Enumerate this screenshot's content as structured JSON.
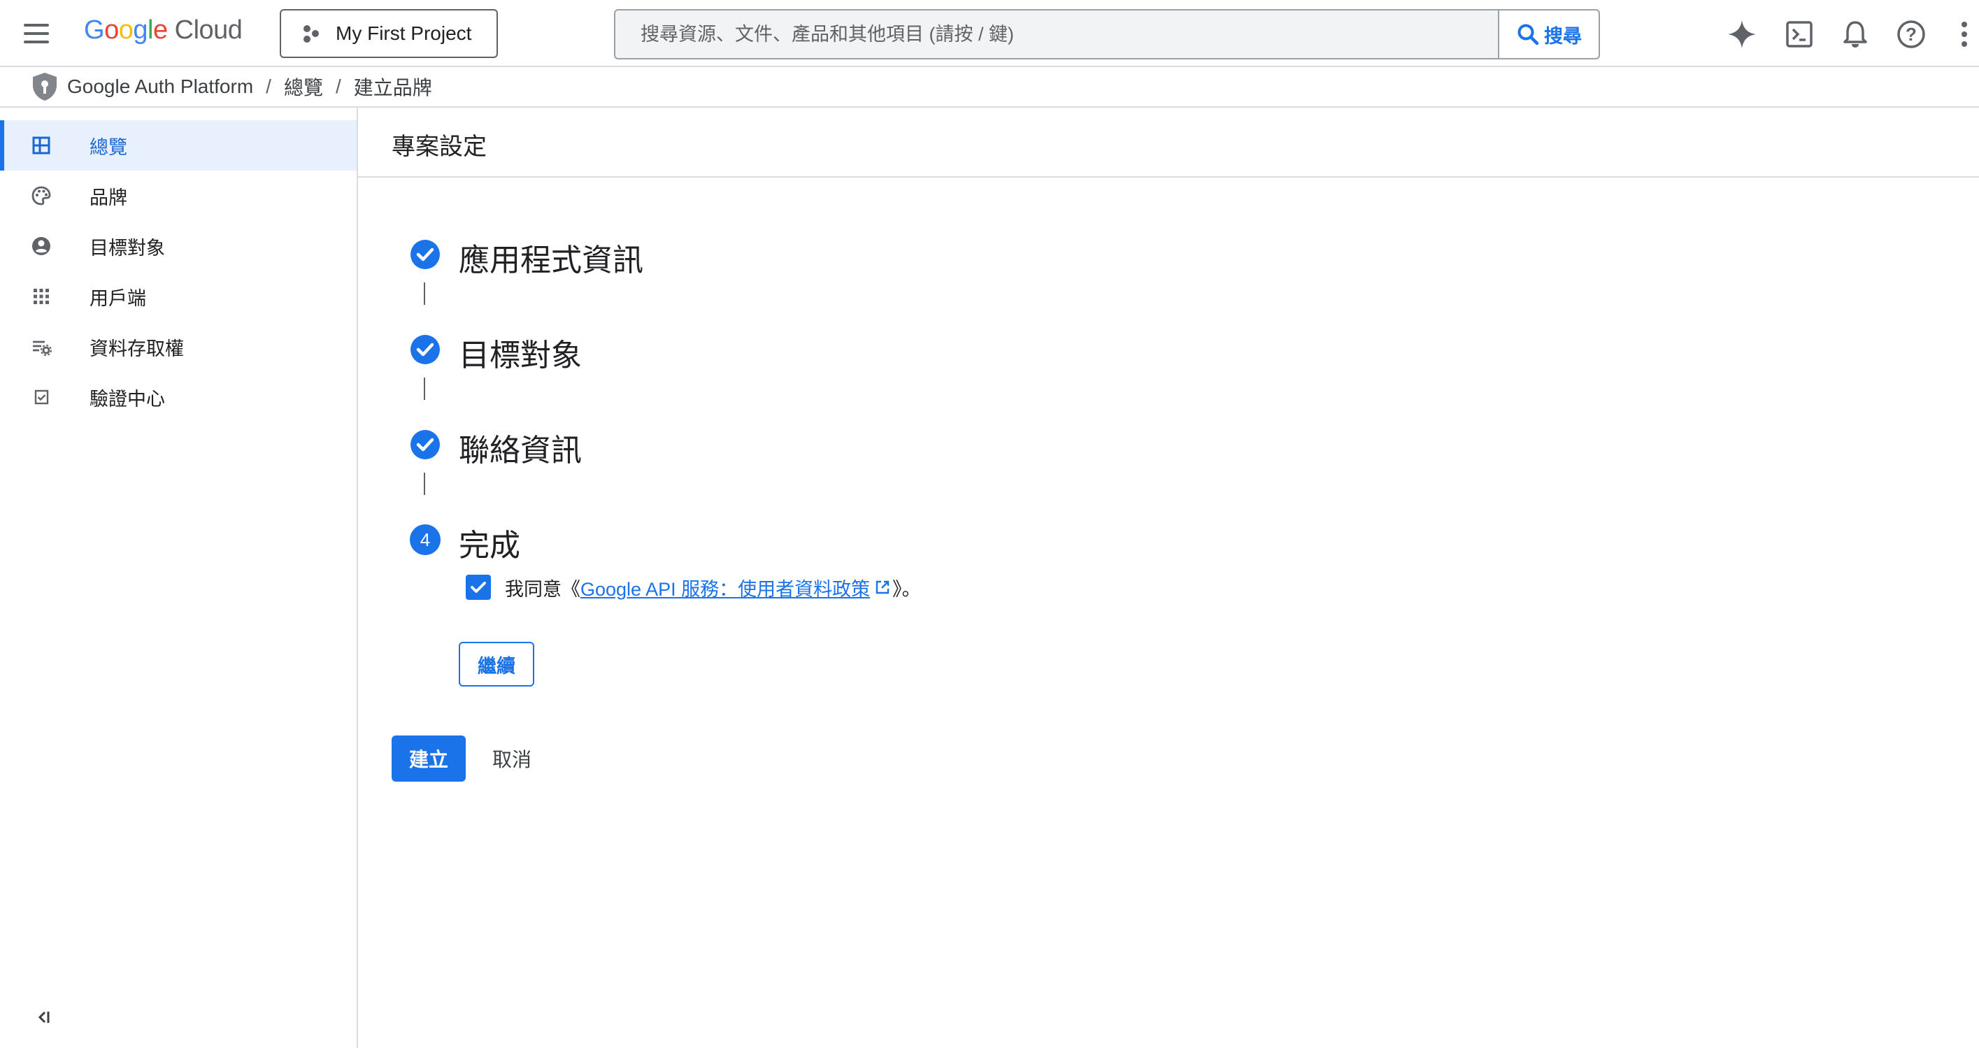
{
  "header": {
    "logo_google": "Google",
    "logo_cloud": "Cloud",
    "project_name": "My First Project",
    "search_placeholder": "搜尋資源、文件、產品和其他項目 (請按 / 鍵)",
    "search_button": "搜尋",
    "icons": [
      "gemini-sparkle-icon",
      "cloud-shell-icon",
      "notifications-bell-icon",
      "help-icon",
      "more-vert-icon"
    ]
  },
  "breadcrumb": {
    "items": [
      "Google Auth Platform",
      "總覽",
      "建立品牌"
    ],
    "separator": "/"
  },
  "sidebar": {
    "items": [
      {
        "label": "總覽",
        "icon": "dashboard-icon",
        "active": true
      },
      {
        "label": "品牌",
        "icon": "palette-icon",
        "active": false
      },
      {
        "label": "目標對象",
        "icon": "account-circle-icon",
        "active": false
      },
      {
        "label": "用戶端",
        "icon": "apps-grid-icon",
        "active": false
      },
      {
        "label": "資料存取權",
        "icon": "data-settings-icon",
        "active": false
      },
      {
        "label": "驗證中心",
        "icon": "verified-checkbox-icon",
        "active": false
      }
    ],
    "collapse_icon": "collapse-left-icon"
  },
  "main": {
    "title": "專案設定",
    "steps": [
      {
        "title": "應用程式資訊",
        "status": "complete"
      },
      {
        "title": "目標對象",
        "status": "complete"
      },
      {
        "title": "聯絡資訊",
        "status": "complete"
      },
      {
        "title": "完成",
        "status": "current",
        "number": "4"
      }
    ],
    "agree": {
      "checked": true,
      "prefix": "我同意《",
      "link_text": "Google API 服務：使用者資料政策",
      "suffix": "》。"
    },
    "continue_label": "繼續",
    "create_label": "建立",
    "cancel_label": "取消"
  },
  "colors": {
    "accent": "#1a73e8",
    "active_bg": "#e8f0fe",
    "border": "#dadce0",
    "text": "#202124",
    "icon": "#5f6368"
  }
}
